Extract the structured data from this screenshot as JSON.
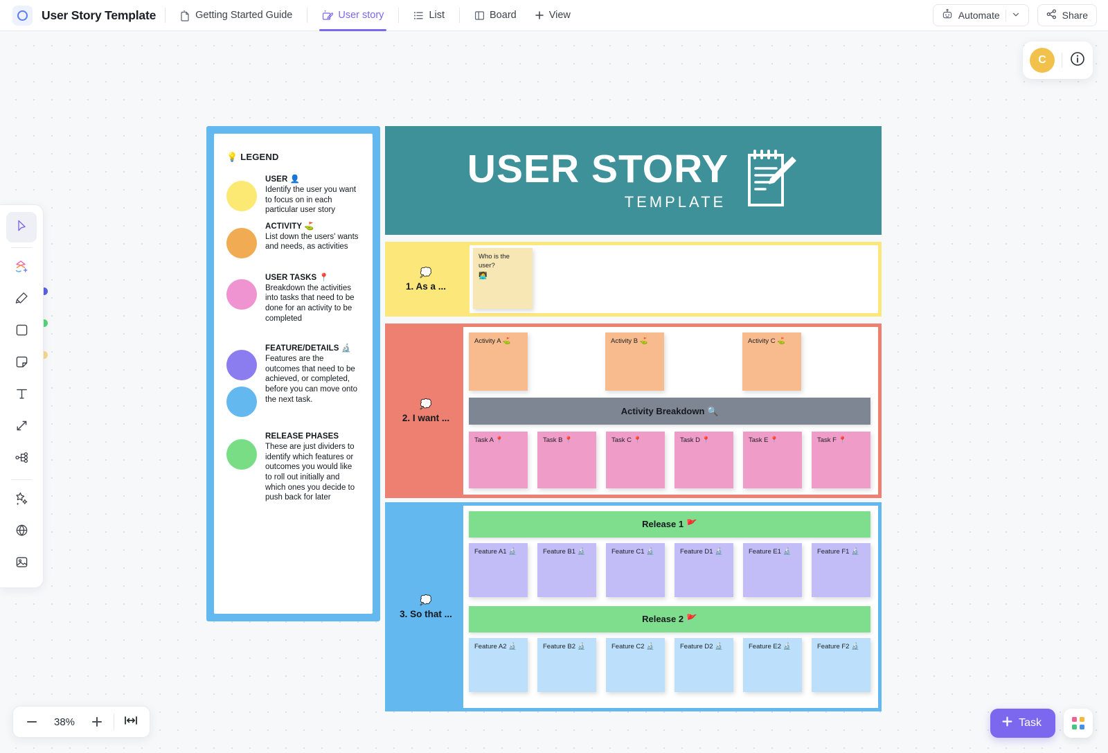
{
  "header": {
    "doc_title": "User Story Template",
    "tabs": [
      {
        "label": "Getting Started Guide",
        "icon": "doc-icon",
        "active": false
      },
      {
        "label": "User story",
        "icon": "whiteboard-icon",
        "active": true
      },
      {
        "label": "List",
        "icon": "list-icon",
        "active": false
      },
      {
        "label": "Board",
        "icon": "board-icon",
        "active": false
      },
      {
        "label": "View",
        "icon": "plus-icon",
        "active": false
      }
    ],
    "automate_label": "Automate",
    "share_label": "Share",
    "accent_color": "#7b68ee"
  },
  "avatar": {
    "initial": "C",
    "color": "#f2c14b"
  },
  "toolbar": {
    "tools": [
      "cursor-select-icon",
      "shapes-add-icon",
      "highlighter-icon",
      "rectangle-icon",
      "sticky-note-icon",
      "text-icon",
      "connector-arrow-icon",
      "mindmap-icon",
      "magic-wand-icon",
      "globe-icon",
      "image-icon"
    ],
    "edge_dots": [
      "#5b5fe8",
      "#53d678",
      "#f6d98a"
    ]
  },
  "zoom": {
    "level": "38%",
    "minus": "−",
    "plus": "+",
    "fit_icon": "fit-to-screen-icon"
  },
  "footer": {
    "task_label": "Task",
    "apps_icon": "apps-grid-icon"
  },
  "board": {
    "legend": {
      "title": "💡 LEGEND",
      "entries": [
        {
          "heading": "USER 👤",
          "body": "Identify the user you want to focus on in each particular user story",
          "colors": [
            "#fbe974"
          ]
        },
        {
          "heading": "ACTIVITY ⛳",
          "body": "List down the users' wants and needs, as activities",
          "colors": [
            "#f0ab53"
          ]
        },
        {
          "heading": "USER TASKS 📍",
          "body": "Breakdown the activities into tasks that need to be done for an activity to be completed",
          "colors": [
            "#ef93d1"
          ]
        },
        {
          "heading": "FEATURE/DETAILS 🔬",
          "body": "Features are the outcomes that need to be achieved, or completed, before you can move onto the next task.",
          "colors": [
            "#8b7df0",
            "#63b8ef"
          ]
        },
        {
          "heading": "RELEASE PHASES",
          "body": "These are just dividers to identify which features or outcomes you would like to roll out initially and which ones you decide to push back for later",
          "colors": [
            "#78dd85"
          ]
        }
      ]
    },
    "banner": {
      "title": "USER STORY",
      "subtitle": "TEMPLATE",
      "icon": "notepad-pencil-icon",
      "color": "#3e9199"
    },
    "rows": [
      {
        "label": "1.  As a ...",
        "bubble": "💭",
        "color": "#fce77a",
        "notes": [
          {
            "text": "Who is the user?",
            "emoji": "🧑‍💻"
          }
        ]
      },
      {
        "label": "2.  I want ...",
        "bubble": "💭",
        "color": "#ed8071",
        "activities": [
          "Activity A ⛳",
          "Activity B ⛳",
          "Activity C ⛳"
        ],
        "breakdown_bar": "Activity Breakdown 🔍",
        "tasks": [
          "Task A 📍",
          "Task B 📍",
          "Task C 📍",
          "Task D 📍",
          "Task E 📍",
          "Task F 📍"
        ]
      },
      {
        "label": "3.  So that ...",
        "bubble": "💭",
        "color": "#63b8ef",
        "releases": [
          {
            "bar": "Release 1 🚩",
            "features": [
              "Feature A1 🔬",
              "Feature B1 🔬",
              "Feature C1 🔬",
              "Feature D1 🔬",
              "Feature E1 🔬",
              "Feature F1 🔬"
            ]
          },
          {
            "bar": "Release 2 🚩",
            "features": [
              "Feature A2 🔬",
              "Feature B2 🔬",
              "Feature C2 🔬",
              "Feature D2 🔬",
              "Feature E2 🔬",
              "Feature F2 🔬"
            ]
          }
        ]
      }
    ]
  }
}
